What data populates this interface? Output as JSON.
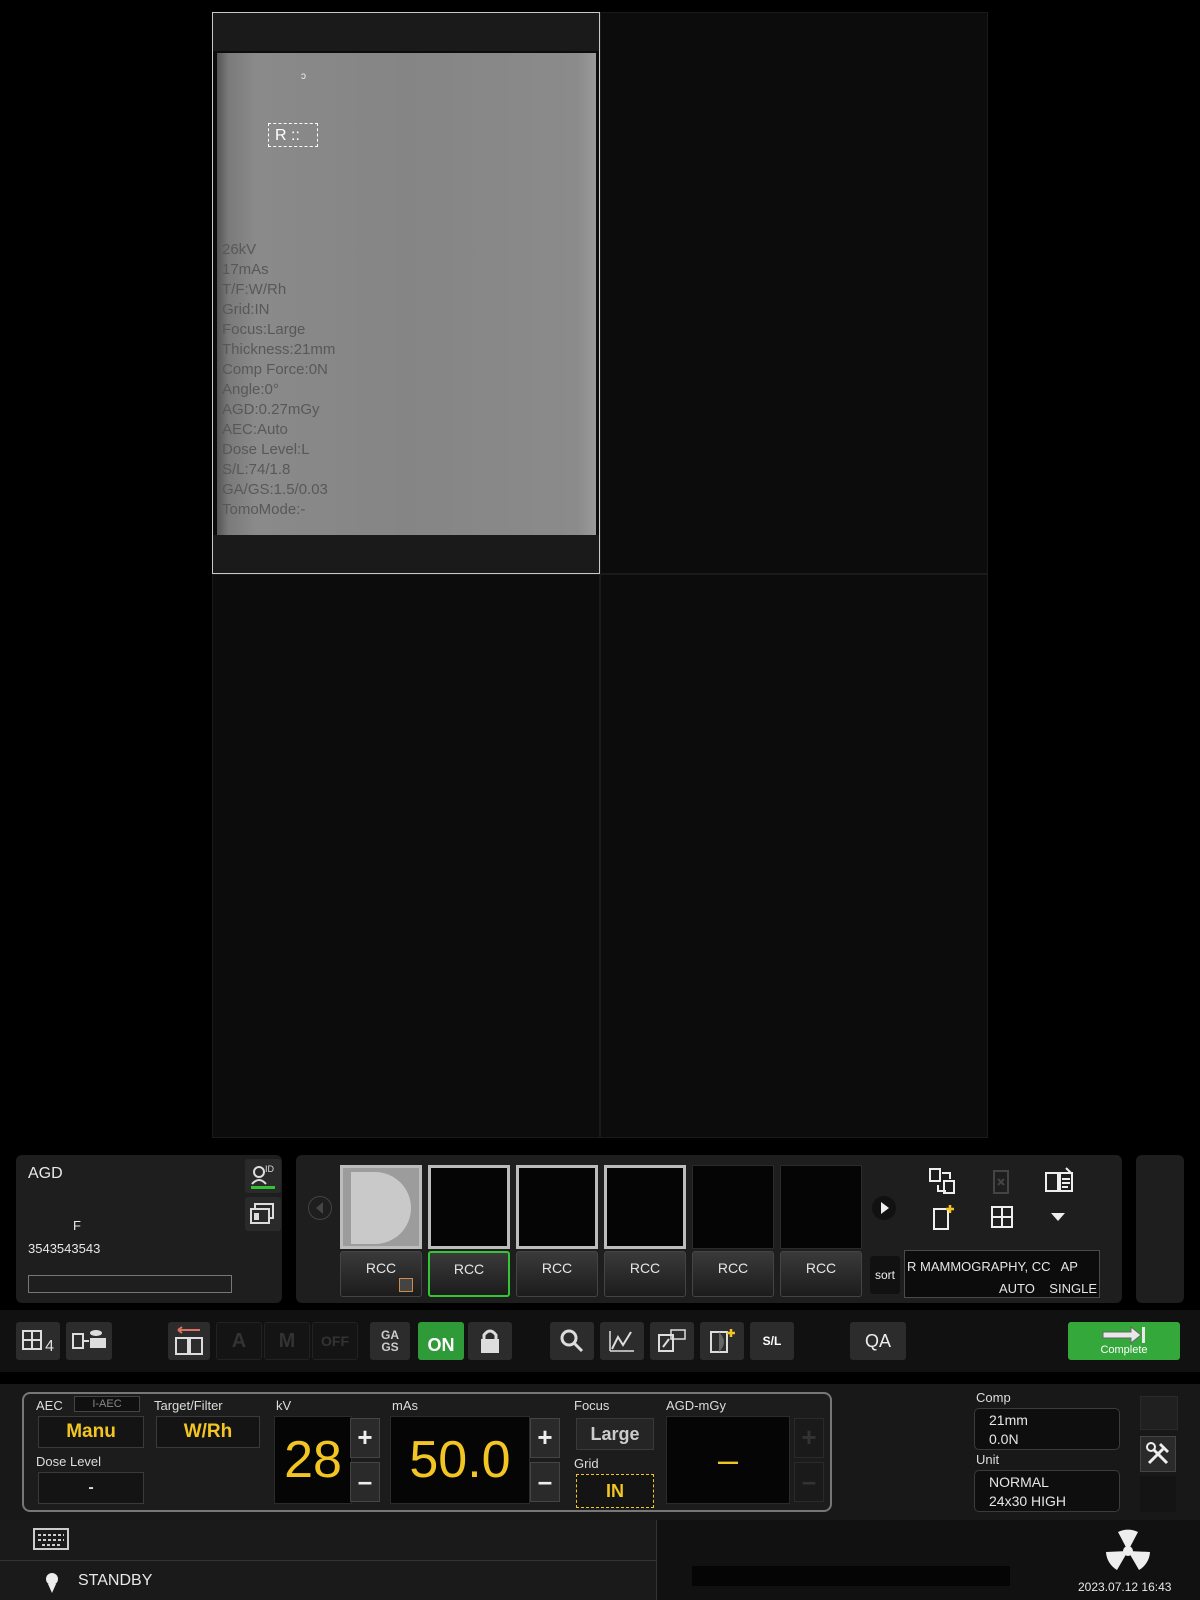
{
  "image_overlay": {
    "marker": "R ::",
    "parameters": [
      "26kV",
      "17mAs",
      "T/F:W/Rh",
      "Grid:IN",
      "Focus:Large",
      "Thickness:21mm",
      "Comp Force:0N",
      "Angle:0°",
      "AGD:0.27mGy",
      "AEC:Auto",
      "Dose Level:L",
      "S/L:74/1.8",
      "GA/GS:1.5/0.03",
      "TomoMode:-"
    ]
  },
  "patient": {
    "agd_label": "AGD",
    "sex": "F",
    "id": "3543543543",
    "id_icon_label": "ID"
  },
  "thumbnails": [
    {
      "label": "RCC"
    },
    {
      "label": "RCC"
    },
    {
      "label": "RCC"
    },
    {
      "label": "RCC"
    },
    {
      "label": "RCC"
    },
    {
      "label": "RCC"
    }
  ],
  "protocol": {
    "sort_label": "sort",
    "line1": "R MAMMOGRAPHY, CC   AP",
    "line2": "AUTO    SINGLE"
  },
  "toolbar": {
    "layout_count": "4",
    "auto_label": "A",
    "manual_label": "M",
    "off_label": "OFF",
    "ga_gs_label": "GA GS",
    "aon_label": "ON",
    "sl_label": "S/L",
    "qa_label": "QA",
    "complete_label": "Complete",
    "complete_color": "#34a83a"
  },
  "exposure": {
    "aec_label": "AEC",
    "i_aec_label": "I-AEC",
    "aec_value": "Manu",
    "target_filter_label": "Target/Filter",
    "target_filter_value": "W/Rh",
    "dose_level_label": "Dose Level",
    "dose_level_value": "-",
    "kv_label": "kV",
    "kv_value": "28",
    "mas_label": "mAs",
    "mas_value": "50.0",
    "focus_label": "Focus",
    "focus_value": "Large",
    "grid_label": "Grid",
    "grid_value": "IN",
    "agd_label": "AGD-mGy",
    "agd_value": "–",
    "accent_color": "#f2c523"
  },
  "comp": {
    "label": "Comp",
    "thickness": "21mm",
    "force": "0.0N",
    "unit_label": "Unit",
    "unit_mode": "NORMAL",
    "unit_size": "24x30 HIGH"
  },
  "status": {
    "state": "STANDBY",
    "datetime": "2023.07.12 16:43"
  }
}
